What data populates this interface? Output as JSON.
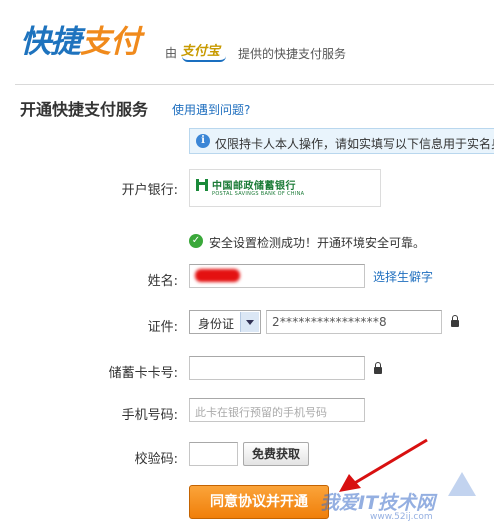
{
  "header": {
    "logo_part1": "快捷",
    "logo_part2": "支付",
    "by": "由",
    "partner_logo_text": "支付宝",
    "provided": "提供的快捷支付服务"
  },
  "section": {
    "title": "开通快捷支付服务",
    "help_link": "使用遇到问题?"
  },
  "notice": {
    "icon_text": "i",
    "text": "仅限持卡人本人操作，请如实填写以下信息用于实名身份"
  },
  "bank": {
    "label": "开户银行:",
    "name_cn": "中国邮政储蓄银行",
    "name_en": "POSTAL SAVINGS BANK OF CHINA"
  },
  "security": {
    "text": "安全设置检测成功！开通环境安全可靠。"
  },
  "form": {
    "name_label": "姓名:",
    "name_link": "选择生僻字",
    "id_label": "证件:",
    "id_type": "身份证",
    "id_value": "2****************8",
    "card_label": "储蓄卡卡号:",
    "phone_label": "手机号码:",
    "phone_placeholder": "此卡在银行预留的手机号码",
    "code_label": "校验码:",
    "sms_button": "免费获取",
    "submit": "同意协议并开通"
  },
  "watermark": {
    "text": "我爱IT技术网",
    "url": "www.52ij.com"
  },
  "colors": {
    "brand_blue": "#1e73be",
    "brand_orange": "#f08a1c",
    "submit_orange": "#f39220",
    "link_blue": "#1f6fbf"
  }
}
